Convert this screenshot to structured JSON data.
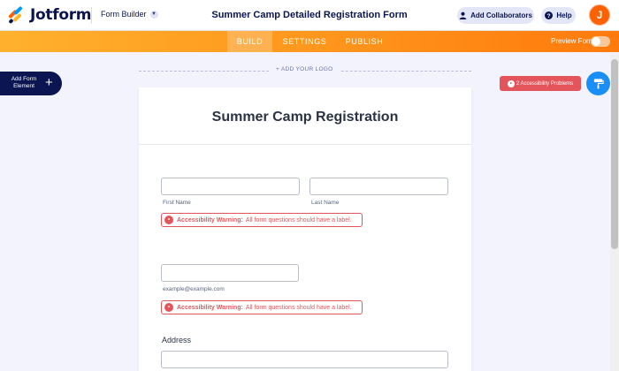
{
  "header": {
    "brand": "Jotform",
    "builder_menu": "Form Builder",
    "form_title": "Summer Camp Detailed Registration Form",
    "collaborators_label": "Add Collaborators",
    "help_label": "Help",
    "avatar_initial": "J"
  },
  "tabs": [
    {
      "label": "BUILD",
      "active": true
    },
    {
      "label": "SETTINGS",
      "active": false
    },
    {
      "label": "PUBLISH",
      "active": false
    }
  ],
  "preview": {
    "label": "Preview Form",
    "enabled": false
  },
  "left_panel": {
    "add_element_label": "Add Form Element",
    "add_icon": "plus-icon"
  },
  "canvas": {
    "add_logo_label": "+ ADD YOUR LOGO"
  },
  "accessibility": {
    "problems_label": "2 Accessibility Problems"
  },
  "form": {
    "heading": "Summer Camp Registration",
    "name_field": {
      "first_sublabel": "First Name",
      "last_sublabel": "Last Name"
    },
    "email_field": {
      "sublabel": "example@example.com"
    },
    "warning": {
      "title": "Accessibility Warning:",
      "message": "All form questions should have a label."
    },
    "address_label": "Address"
  },
  "colors": {
    "brand_navy": "#0a1551",
    "orange": "#ff7a0c",
    "warning_red": "#e4555b",
    "designer_blue": "#1b8ef6"
  }
}
